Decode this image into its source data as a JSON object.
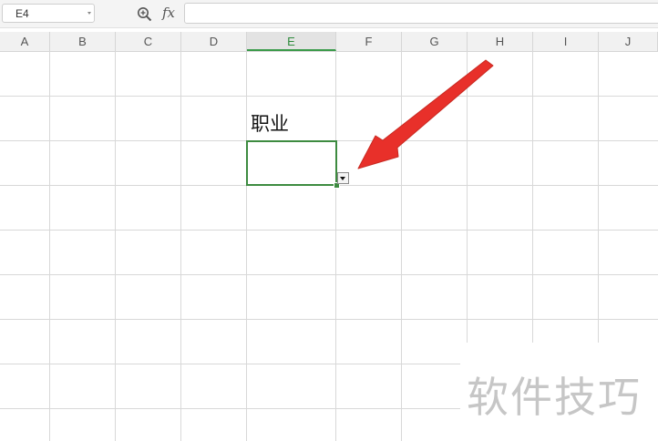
{
  "formula_bar": {
    "name_box_value": "E4",
    "fx_label": "fx",
    "formula_value": ""
  },
  "columns": [
    "A",
    "B",
    "C",
    "D",
    "E",
    "F",
    "G",
    "H",
    "I",
    "J"
  ],
  "selected_column": "E",
  "cells": {
    "E3": "职业",
    "E4": ""
  },
  "active_cell": "E4",
  "annotation": {
    "type": "red-arrow",
    "color": "#e8302a",
    "points_to": "dropdown-button"
  },
  "watermark": "软件技巧",
  "icons": {
    "zoom": "zoom-formula-icon",
    "dropdown": "dropdown-triangle-icon"
  },
  "colors": {
    "selection_border": "#3d8b40",
    "selected_header_text": "#2e8b3d",
    "gridline": "#d8d8d8",
    "arrow": "#e8302a"
  }
}
